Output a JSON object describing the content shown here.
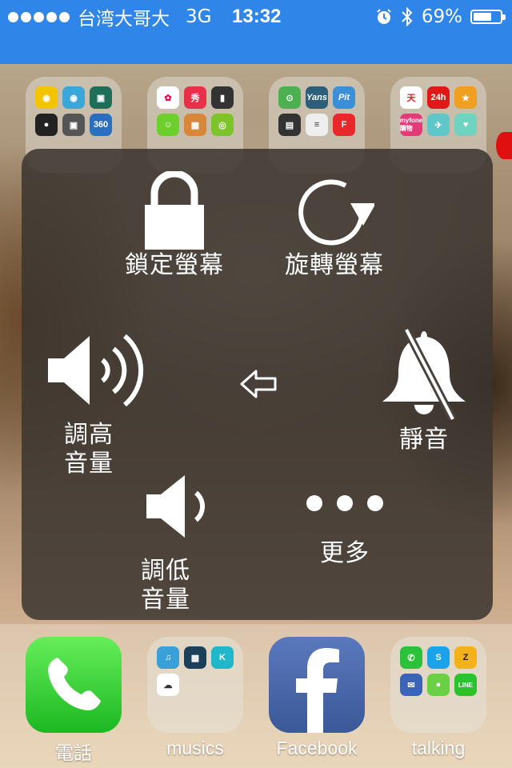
{
  "status_bar": {
    "carrier": "台湾大哥大",
    "network": "3G",
    "time": "13:32",
    "battery_percent": "69%",
    "battery_level": 0.69,
    "signal_bars": 5,
    "icons": [
      "alarm-icon",
      "bluetooth-icon",
      "battery-icon"
    ]
  },
  "colors": {
    "status_bar_bg": "#2f86e8",
    "panel_bg": "rgba(58,52,48,0.86)",
    "phone_green": "#3cd640",
    "facebook_blue": "#3b5998"
  },
  "assistive_touch": {
    "lock_screen": "鎖定螢幕",
    "rotate_screen": "旋轉螢幕",
    "volume_up": "調高\n音量",
    "mute": "靜音",
    "back_icon": "back-arrow-icon",
    "volume_down": "調低\n音量",
    "more": "更多"
  },
  "dock": {
    "apps": [
      {
        "label": "電話",
        "icon": "phone-icon"
      },
      {
        "label": "musics",
        "icon": "folder-icon"
      },
      {
        "label": "Facebook",
        "icon": "facebook-icon"
      },
      {
        "label": "talking",
        "icon": "folder-icon"
      }
    ]
  },
  "folders_top": {
    "folder3_apps": [
      "Yans",
      "Pit"
    ],
    "folder4_apps": [
      "天",
      "24h",
      "myfone 購物"
    ]
  }
}
